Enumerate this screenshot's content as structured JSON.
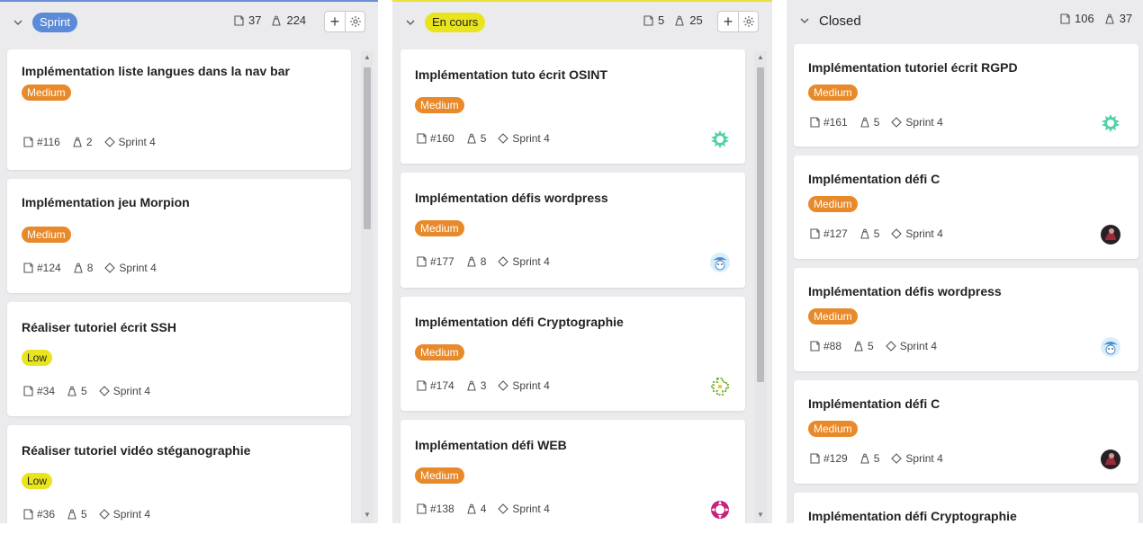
{
  "columns": [
    {
      "title": "Sprint",
      "ticket_count": "37",
      "points": "224",
      "cards": [
        {
          "title": "Implémentation liste langues dans la nav bar",
          "priority": "Medium",
          "number": "#116",
          "points": "2",
          "milestone": "Sprint 4"
        },
        {
          "title": "Implémentation jeu Morpion",
          "priority": "Medium",
          "number": "#124",
          "points": "8",
          "milestone": "Sprint 4"
        },
        {
          "title": "Réaliser tutoriel écrit SSH",
          "priority": "Low",
          "number": "#34",
          "points": "5",
          "milestone": "Sprint 4"
        },
        {
          "title": "Réaliser tutoriel vidéo stéganographie",
          "priority": "Low",
          "number": "#36",
          "points": "5",
          "milestone": "Sprint 4"
        }
      ]
    },
    {
      "title": "En cours",
      "ticket_count": "5",
      "points": "25",
      "cards": [
        {
          "title": "Implémentation tuto écrit OSINT",
          "priority": "Medium",
          "number": "#160",
          "points": "5",
          "milestone": "Sprint 4"
        },
        {
          "title": "Implémentation défis wordpress",
          "priority": "Medium",
          "number": "#177",
          "points": "8",
          "milestone": "Sprint 4"
        },
        {
          "title": "Implémentation défi Cryptographie",
          "priority": "Medium",
          "number": "#174",
          "points": "3",
          "milestone": "Sprint 4"
        },
        {
          "title": "Implémentation défi WEB",
          "priority": "Medium",
          "number": "#138",
          "points": "4",
          "milestone": "Sprint 4"
        }
      ]
    },
    {
      "title": "Closed",
      "ticket_count": "106",
      "points": "37",
      "cards": [
        {
          "title": "Implémentation tutoriel écrit RGPD",
          "priority": "Medium",
          "number": "#161",
          "points": "5",
          "milestone": "Sprint 4"
        },
        {
          "title": "Implémentation défi C",
          "priority": "Medium",
          "number": "#127",
          "points": "5",
          "milestone": "Sprint 4"
        },
        {
          "title": "Implémentation défis wordpress",
          "priority": "Medium",
          "number": "#88",
          "points": "5",
          "milestone": "Sprint 4"
        },
        {
          "title": "Implémentation défi C",
          "priority": "Medium",
          "number": "#129",
          "points": "5",
          "milestone": "Sprint 4"
        },
        {
          "title": "Implémentation défi Cryptographie"
        }
      ]
    }
  ],
  "colors": {
    "sprint_pill": "#5b8ad6",
    "en_cours_pill": "#e9e41e",
    "medium_badge": "#e8892a",
    "low_badge": "#e9e41e",
    "column_bg": "#ebebee"
  },
  "icons": {
    "collapse": "chevron-down-icon",
    "tickets": "ticket-icon",
    "points": "weight-icon",
    "milestone": "diamond-milestone-icon",
    "add": "plus-icon",
    "settings": "gear-icon"
  }
}
